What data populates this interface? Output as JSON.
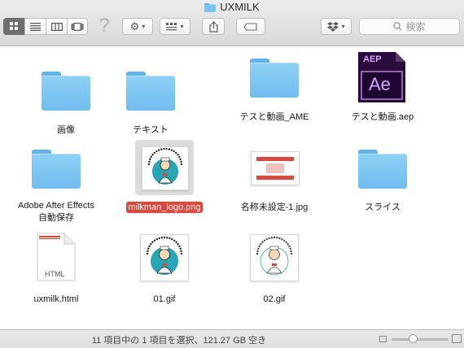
{
  "window": {
    "title": "UXMILK"
  },
  "toolbar": {
    "view_modes": [
      {
        "name": "icon-view",
        "icon": "grid-icon"
      },
      {
        "name": "list-view",
        "icon": "list-icon"
      },
      {
        "name": "column-view",
        "icon": "columns-icon"
      },
      {
        "name": "coverflow-view",
        "icon": "coverflow-icon"
      }
    ],
    "help_glyph": "?",
    "search_placeholder": "検索"
  },
  "files": [
    {
      "label": "画像",
      "kind": "folder"
    },
    {
      "label": "テキスト",
      "kind": "folder"
    },
    {
      "label": "テスと動画_AME",
      "kind": "folder"
    },
    {
      "label": "テスと動画.aep",
      "kind": "aep",
      "icon_tag": "AEP",
      "icon_text": "Ae"
    },
    {
      "label_line1": "Adobe After Effects",
      "label_line2": "自動保存",
      "kind": "folder"
    },
    {
      "label": "milkman_logo.png",
      "kind": "image",
      "selected": true
    },
    {
      "label": "名称未設定-1.jpg",
      "kind": "image-red"
    },
    {
      "label": "スライス",
      "kind": "folder"
    },
    {
      "label": "uxmilk.html",
      "kind": "html",
      "icon_text": "HTML"
    },
    {
      "label": "01.gif",
      "kind": "image"
    },
    {
      "label": "02.gif",
      "kind": "image"
    }
  ],
  "status": {
    "text": "11 項目中の 1 項目を選択、121.27 GB 空き",
    "icon_size_level": 0.35
  },
  "colors": {
    "folder": "#7cc5f2",
    "selection_label": "#e0473c",
    "ae_purple": "#2a0b3b",
    "ae_accent": "#d8a3ff"
  }
}
